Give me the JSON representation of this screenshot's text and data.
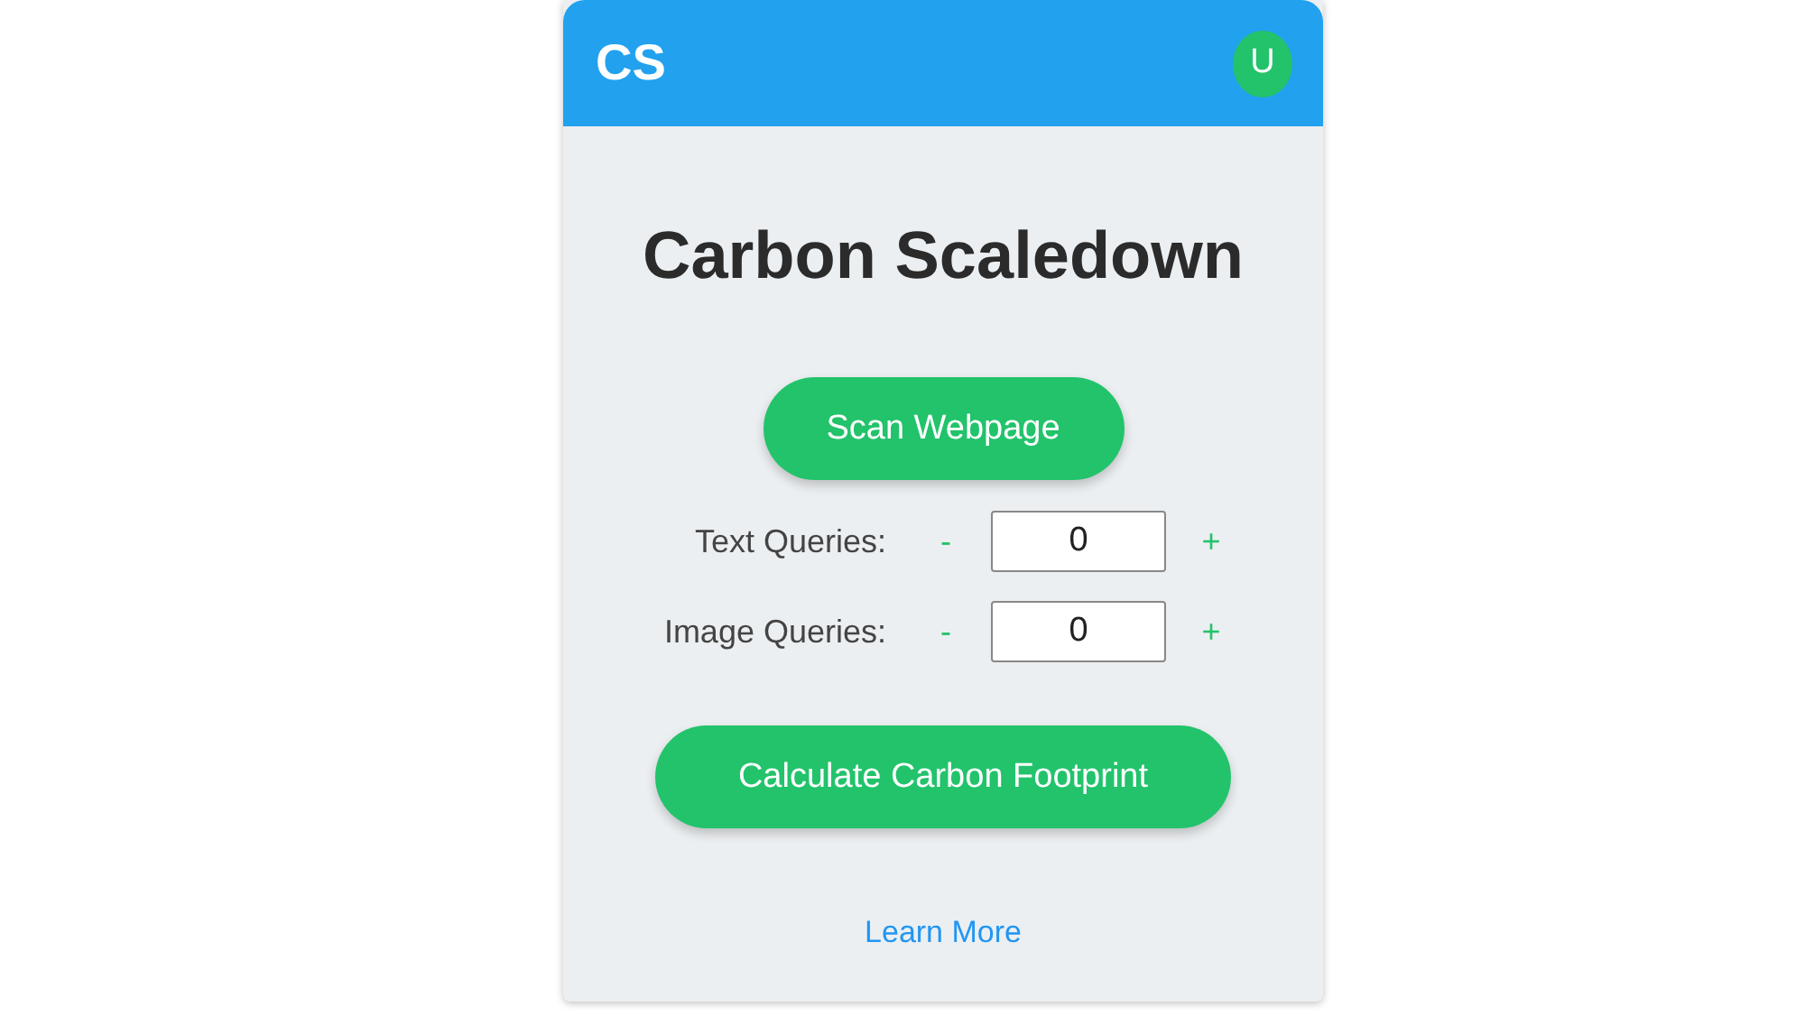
{
  "header": {
    "logo": "CS",
    "avatar": "U"
  },
  "title": "Carbon Scaledown",
  "scan_button": "Scan Webpage",
  "counters": [
    {
      "label": "Text Queries:",
      "decrement": "-",
      "value": "0",
      "increment": "+"
    },
    {
      "label": "Image Queries:",
      "decrement": "-",
      "value": "0",
      "increment": "+"
    }
  ],
  "calculate_button": "Calculate Carbon Footprint",
  "link": "Learn More"
}
